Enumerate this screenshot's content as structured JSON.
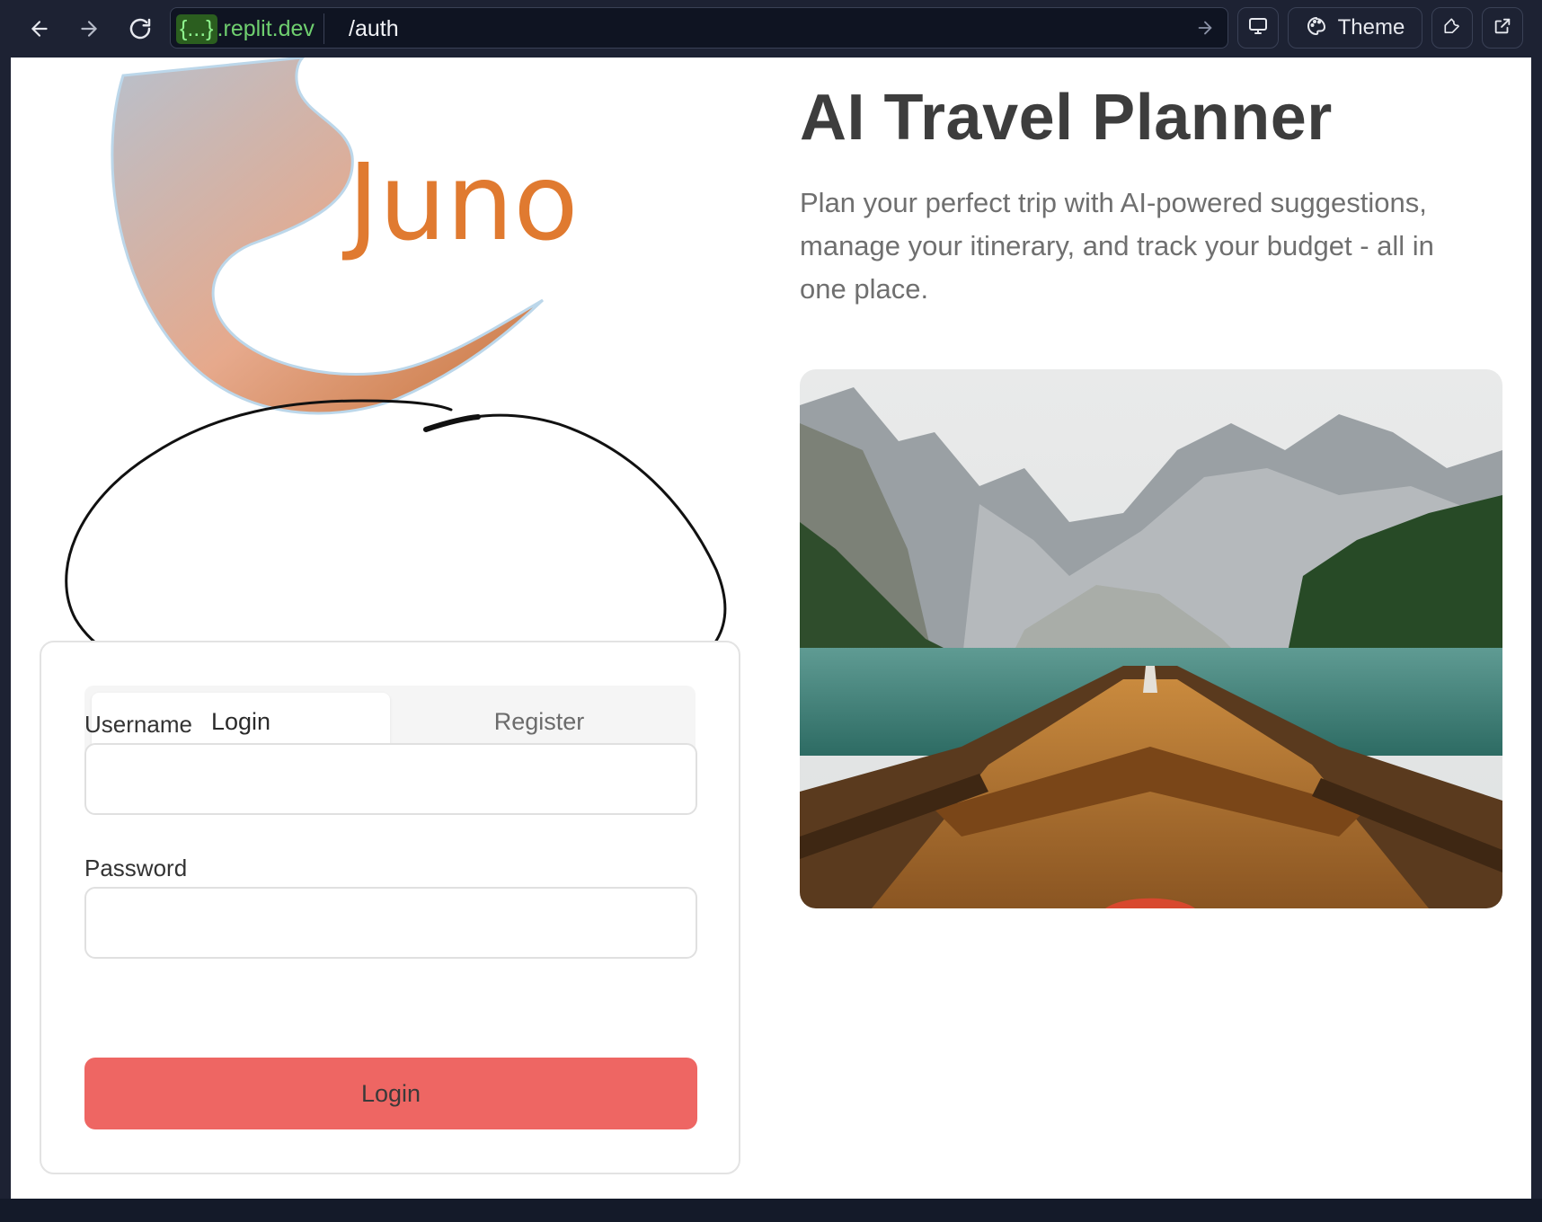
{
  "browser": {
    "url_domain_brace": "{...}",
    "url_domain_rest": ".replit.dev",
    "url_path": "/auth",
    "theme_label": "Theme"
  },
  "logo": {
    "text": "Juno",
    "color": "#e07a30"
  },
  "hero": {
    "title": "AI Travel Planner",
    "description": "Plan your perfect trip with AI-powered suggestions, manage your itinerary, and track your budget - all in one place."
  },
  "auth": {
    "tabs": [
      {
        "label": "Login",
        "active": true
      },
      {
        "label": "Register",
        "active": false
      }
    ],
    "username_label": "Username",
    "username_value": "",
    "password_label": "Password",
    "password_value": "",
    "submit_label": "Login",
    "submit_color": "#ee6663"
  },
  "icons": {
    "back": "arrow-left-icon",
    "forward": "arrow-right-icon",
    "reload": "reload-icon",
    "go": "arrow-right-icon",
    "device": "monitor-icon",
    "theme": "palette-icon",
    "devtools": "wrench-icon",
    "open_external": "external-link-icon"
  }
}
